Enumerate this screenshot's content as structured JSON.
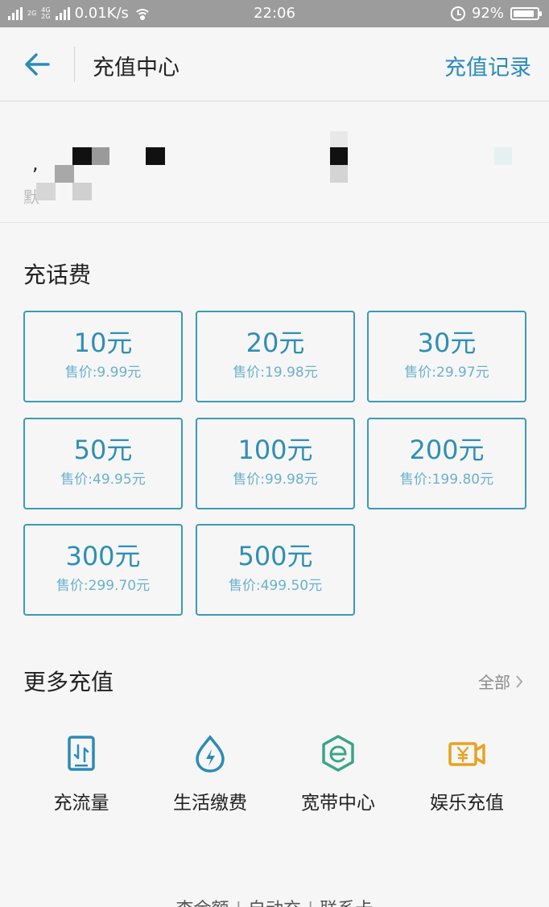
{
  "status_bar": {
    "net_small": "2G",
    "net_small2": "4G",
    "net_small3": "2G",
    "speed": "0.01K/s",
    "time": "22:06",
    "battery": "92%",
    "battery_level": 0.92
  },
  "header": {
    "title": "充值中心",
    "records": "充值记录"
  },
  "account": {
    "comma": ",",
    "default_label": "默"
  },
  "phone_section": {
    "title": "充话费",
    "tiles": [
      {
        "amount": "10元",
        "price": "售价:9.99元"
      },
      {
        "amount": "20元",
        "price": "售价:19.98元"
      },
      {
        "amount": "30元",
        "price": "售价:29.97元"
      },
      {
        "amount": "50元",
        "price": "售价:49.95元"
      },
      {
        "amount": "100元",
        "price": "售价:99.98元"
      },
      {
        "amount": "200元",
        "price": "售价:199.80元"
      },
      {
        "amount": "300元",
        "price": "售价:299.70元"
      },
      {
        "amount": "500元",
        "price": "售价:499.50元"
      }
    ]
  },
  "more_section": {
    "title": "更多充值",
    "all": "全部",
    "services": [
      {
        "label": "充流量",
        "icon": "data-traffic-icon"
      },
      {
        "label": "生活缴费",
        "icon": "utility-payment-icon"
      },
      {
        "label": "宽带中心",
        "icon": "broadband-icon"
      },
      {
        "label": "娱乐充值",
        "icon": "entertainment-icon"
      }
    ]
  },
  "footer": {
    "links": [
      "查余额",
      "自动充",
      "联系卡"
    ]
  },
  "colors": {
    "accent": "#2b8bb8",
    "tile_border": "#3a9ab9",
    "broadband": "#3aa589",
    "entertainment": "#e8a220"
  }
}
